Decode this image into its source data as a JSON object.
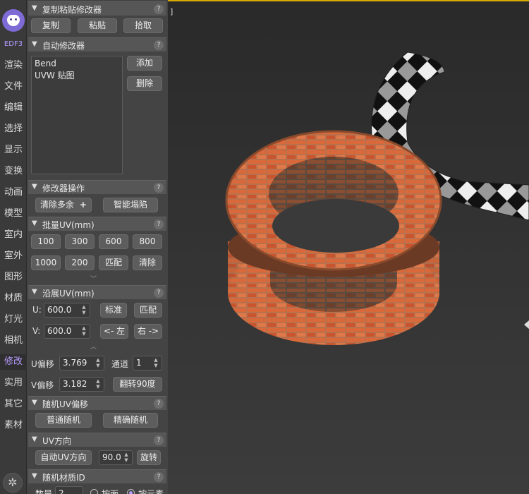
{
  "nav": {
    "brand": "EDF3",
    "items": [
      "渲染",
      "文件",
      "编辑",
      "选择",
      "显示",
      "变换",
      "动画",
      "模型",
      "室内",
      "室外",
      "图形",
      "材质",
      "灯光",
      "相机",
      "修改",
      "实用",
      "其它",
      "素材"
    ],
    "active": "修改"
  },
  "sections": {
    "copy_paste": {
      "title": "复制粘贴修改器",
      "copy": "复制",
      "paste": "粘贴",
      "pick": "拾取"
    },
    "auto_modifier": {
      "title": "自动修改器",
      "list": [
        "Bend",
        "UVW 贴图"
      ],
      "add": "添加",
      "delete": "删除"
    },
    "modifier_ops": {
      "title": "修改器操作",
      "clear_extra": "清除多余",
      "plus": "+",
      "smart_collapse": "智能塌陷"
    },
    "batch_uv": {
      "title": "批量UV(mm)",
      "buttons_row1": [
        "100",
        "300",
        "600",
        "800"
      ],
      "buttons_row2": [
        "1000",
        "200",
        "匹配",
        "清除"
      ]
    },
    "extend_uv": {
      "title": "沿展UV(mm)",
      "u_label": "U:",
      "u_value": "600.0",
      "standard": "标准",
      "match": "匹配",
      "v_label": "V:",
      "v_value": "600.0",
      "left": "<- 左",
      "right": "右 ->",
      "u_offset_label": "U偏移",
      "u_offset": "3.769",
      "channel_label": "通道",
      "channel": "1",
      "v_offset_label": "V偏移",
      "v_offset": "3.182",
      "flip90": "翻转90度"
    },
    "random_uv": {
      "title": "随机UV偏移",
      "normal": "普通随机",
      "precise": "精确随机"
    },
    "uv_direction": {
      "title": "UV方向",
      "auto": "自动UV方向",
      "angle": "90.0",
      "rotate": "旋转"
    },
    "random_mat": {
      "title": "随机材质ID",
      "count_label": "数量",
      "count": "2",
      "opt1": "按面",
      "opt2": "按元素"
    }
  },
  "help_glyph": "?",
  "viewport": {
    "corner_label": "]"
  },
  "colors": {
    "accent": "#b79cff",
    "brand_bg": "#7e6bd6",
    "viewport_border": "#d6a800"
  }
}
